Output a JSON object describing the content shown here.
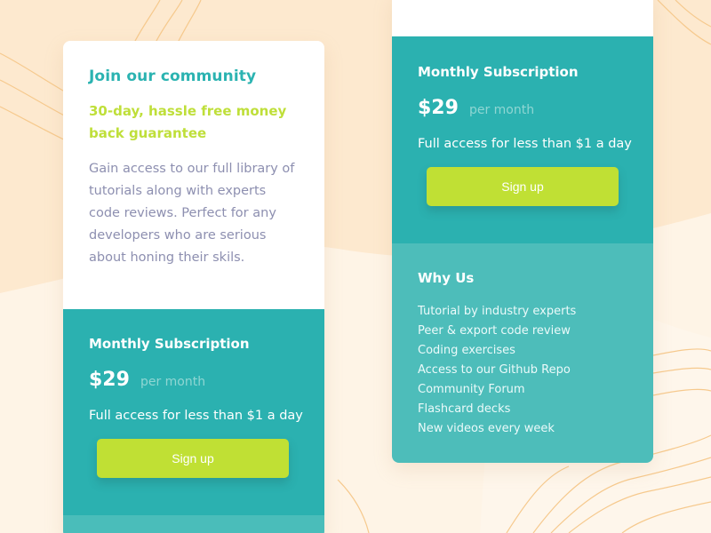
{
  "colors": {
    "background": "#fde9cf",
    "teal": "#2bb1b0",
    "light_teal": "#4dbdba",
    "lime": "#c0e034",
    "title_teal": "#2bb3b1",
    "text_gray": "#8d8fb0"
  },
  "left_card": {
    "title": "Join our community",
    "guarantee": "30-day, hassle free money back guarantee",
    "description": "Gain access to our full library of tutorials along with experts code reviews. Perfect for any developers who are serious about honing their skils.",
    "subscription": {
      "title": "Monthly Subscription",
      "price": "$29",
      "period": "per month",
      "access": "Full access for less than $1 a day",
      "button": "Sign up"
    }
  },
  "right_card": {
    "subscription": {
      "title": "Monthly Subscription",
      "price": "$29",
      "period": "per month",
      "access": "Full access for less than $1 a day",
      "button": "Sign up"
    },
    "why_us": {
      "title": "Why Us",
      "items": [
        "Tutorial by industry experts",
        "Peer & export code review",
        "Coding exercises",
        "Access to our Github Repo",
        "Community Forum",
        "Flashcard decks",
        "New videos every week"
      ]
    }
  }
}
